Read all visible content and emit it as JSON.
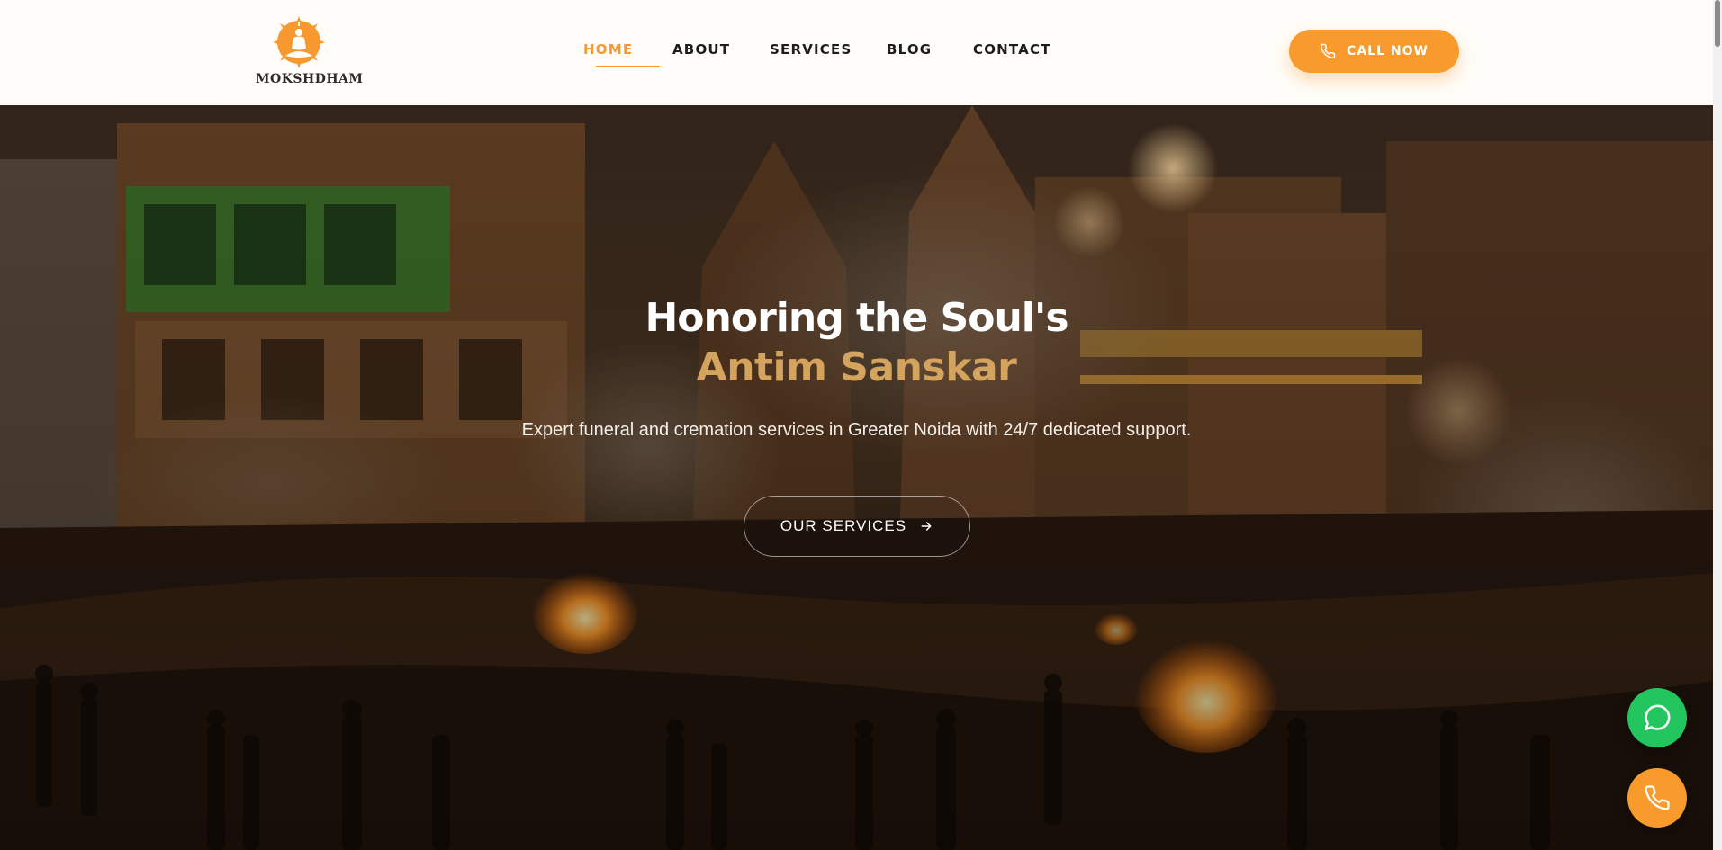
{
  "brand": {
    "name": "MOKSHDHAM",
    "accent_color": "#f99a2c",
    "logo_icon": "meditating-figure-logo"
  },
  "nav": {
    "items": [
      {
        "label": "HOME",
        "active": true
      },
      {
        "label": "ABOUT",
        "active": false
      },
      {
        "label": "SERVICES",
        "active": false
      },
      {
        "label": "BLOG",
        "active": false
      },
      {
        "label": "CONTACT",
        "active": false
      }
    ]
  },
  "header": {
    "call_button": {
      "label": "CALL NOW",
      "icon": "phone-icon"
    }
  },
  "hero": {
    "title_line1": "Honoring the Soul's",
    "title_line2": "Antim Sanskar",
    "title_line2_color": "#d4a35e",
    "subtitle": "Expert funeral and cremation services in Greater Noida with 24/7 dedicated support.",
    "cta": {
      "label": "OUR SERVICES",
      "icon": "arrow-right-icon"
    },
    "background": "cremation-ghat-night-scene"
  },
  "floating": {
    "whatsapp": {
      "icon": "whatsapp-icon",
      "color": "#22c55e"
    },
    "call": {
      "icon": "phone-icon",
      "color": "#f99a2c"
    }
  }
}
